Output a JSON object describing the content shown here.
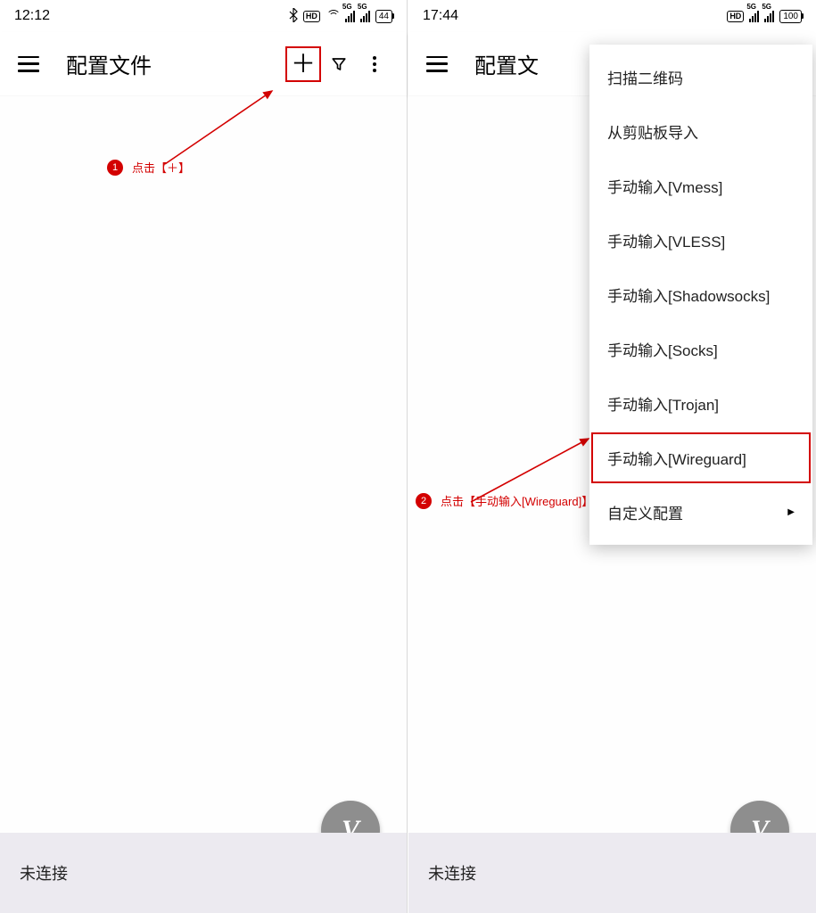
{
  "left": {
    "status": {
      "time": "12:12",
      "battery": "44"
    },
    "title": "配置文件",
    "bottom_status": "未连接",
    "annotation": {
      "num": "1",
      "text": "点击【＋】"
    }
  },
  "right": {
    "status": {
      "time": "17:44",
      "battery": "100"
    },
    "title": "配置文",
    "bottom_status": "未连接",
    "menu": [
      "扫描二维码",
      "从剪贴板导入",
      "手动输入[Vmess]",
      "手动输入[VLESS]",
      "手动输入[Shadowsocks]",
      "手动输入[Socks]",
      "手动输入[Trojan]",
      "手动输入[Wireguard]",
      "自定义配置"
    ],
    "annotation": {
      "num": "2",
      "text": "点击【手动输入[Wireguard]】"
    }
  },
  "fab_glyph": "V"
}
